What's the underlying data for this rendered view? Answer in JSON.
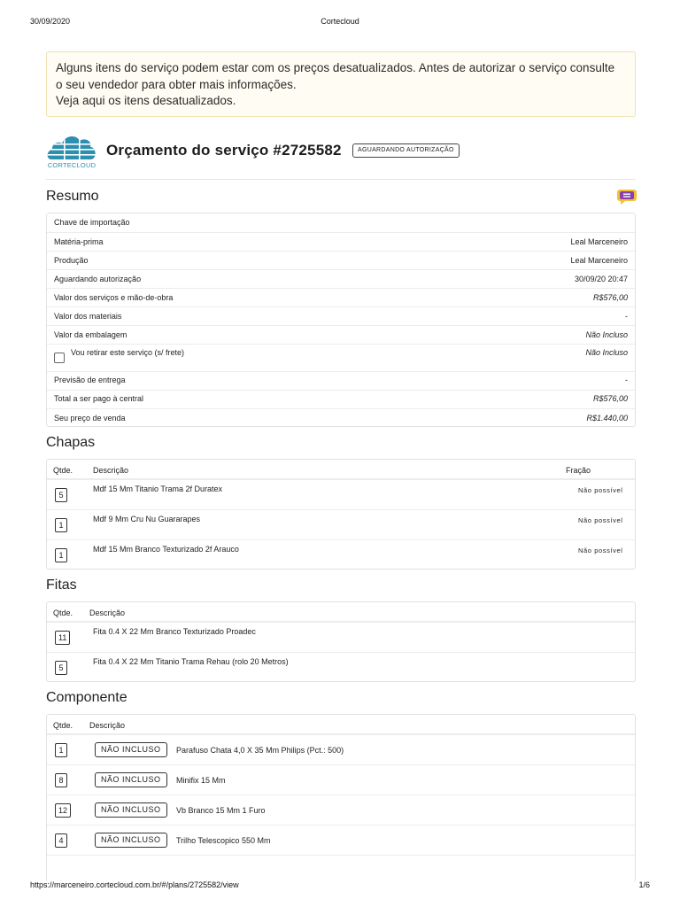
{
  "print_header": {
    "date": "30/09/2020",
    "title": "Cortecloud"
  },
  "print_footer": {
    "url": "https://marceneiro.cortecloud.com.br/#/plans/2725582/view",
    "page": "1/6"
  },
  "alert": {
    "line1": "Alguns itens do serviço podem estar com os preços desatualizados. Antes de autorizar o serviço consulte",
    "line2": "o seu vendedor para obter mais informações.",
    "line3": "Veja aqui os itens desatualizados."
  },
  "brand": {
    "logo_text": "CORTECLOUD",
    "color": "#2d8fb0"
  },
  "title": "Orçamento do serviço #2725582",
  "status": "AGUARDANDO AUTORIZAÇÃO",
  "resumo": {
    "title": "Resumo",
    "rows": [
      {
        "label": "Chave de importação",
        "value": ""
      },
      {
        "label": "Matéria-prima",
        "value": "Leal Marceneiro"
      },
      {
        "label": "Produção",
        "value": "Leal Marceneiro"
      },
      {
        "label": "Aguardando autorização",
        "value": "30/09/20 20:47"
      },
      {
        "label": "Valor dos serviços e mão-de-obra",
        "value": "R$576,00"
      },
      {
        "label": "Valor dos materiais",
        "value": "-"
      },
      {
        "label": "Valor da embalagem",
        "value": "Não Incluso"
      },
      {
        "label": "Vou retirar este serviço (s/ frete)",
        "value": "Não Incluso"
      },
      {
        "label": "Previsão de entrega",
        "value": "-"
      },
      {
        "label": "Total a ser pago à central",
        "value": "R$576,00"
      },
      {
        "label": "Seu preço de venda",
        "value": "R$1.440,00"
      }
    ]
  },
  "chapas": {
    "title": "Chapas",
    "headers": {
      "qty": "Qtde.",
      "desc": "Descrição",
      "fraction": "Fração"
    },
    "rows": [
      {
        "qty": "5",
        "desc": "Mdf 15 Mm Titanio Trama 2f Duratex",
        "fraction": "Não possível"
      },
      {
        "qty": "1",
        "desc": "Mdf 9 Mm Cru Nu Guararapes",
        "fraction": "Não possível"
      },
      {
        "qty": "1",
        "desc": "Mdf 15 Mm Branco Texturizado 2f Arauco",
        "fraction": "Não possível"
      }
    ]
  },
  "fitas": {
    "title": "Fitas",
    "headers": {
      "qty": "Qtde.",
      "desc": "Descrição"
    },
    "rows": [
      {
        "qty": "11",
        "desc": "Fita 0.4 X 22 Mm Branco Texturizado Proadec"
      },
      {
        "qty": "5",
        "desc": "Fita 0.4 X 22 Mm Titanio Trama Rehau (rolo 20 Metros)"
      }
    ]
  },
  "componente": {
    "title": "Componente",
    "headers": {
      "qty": "Qtde.",
      "desc": "Descrição"
    },
    "badge": "NÃO INCLUSO",
    "rows": [
      {
        "qty": "1",
        "desc": "Parafuso Chata 4,0 X 35 Mm Philips (Pct.: 500)"
      },
      {
        "qty": "8",
        "desc": "Minifix 15 Mm"
      },
      {
        "qty": "12",
        "desc": "Vb Branco 15 Mm 1 Furo"
      },
      {
        "qty": "4",
        "desc": "Trilho Telescopico 550 Mm"
      }
    ]
  }
}
